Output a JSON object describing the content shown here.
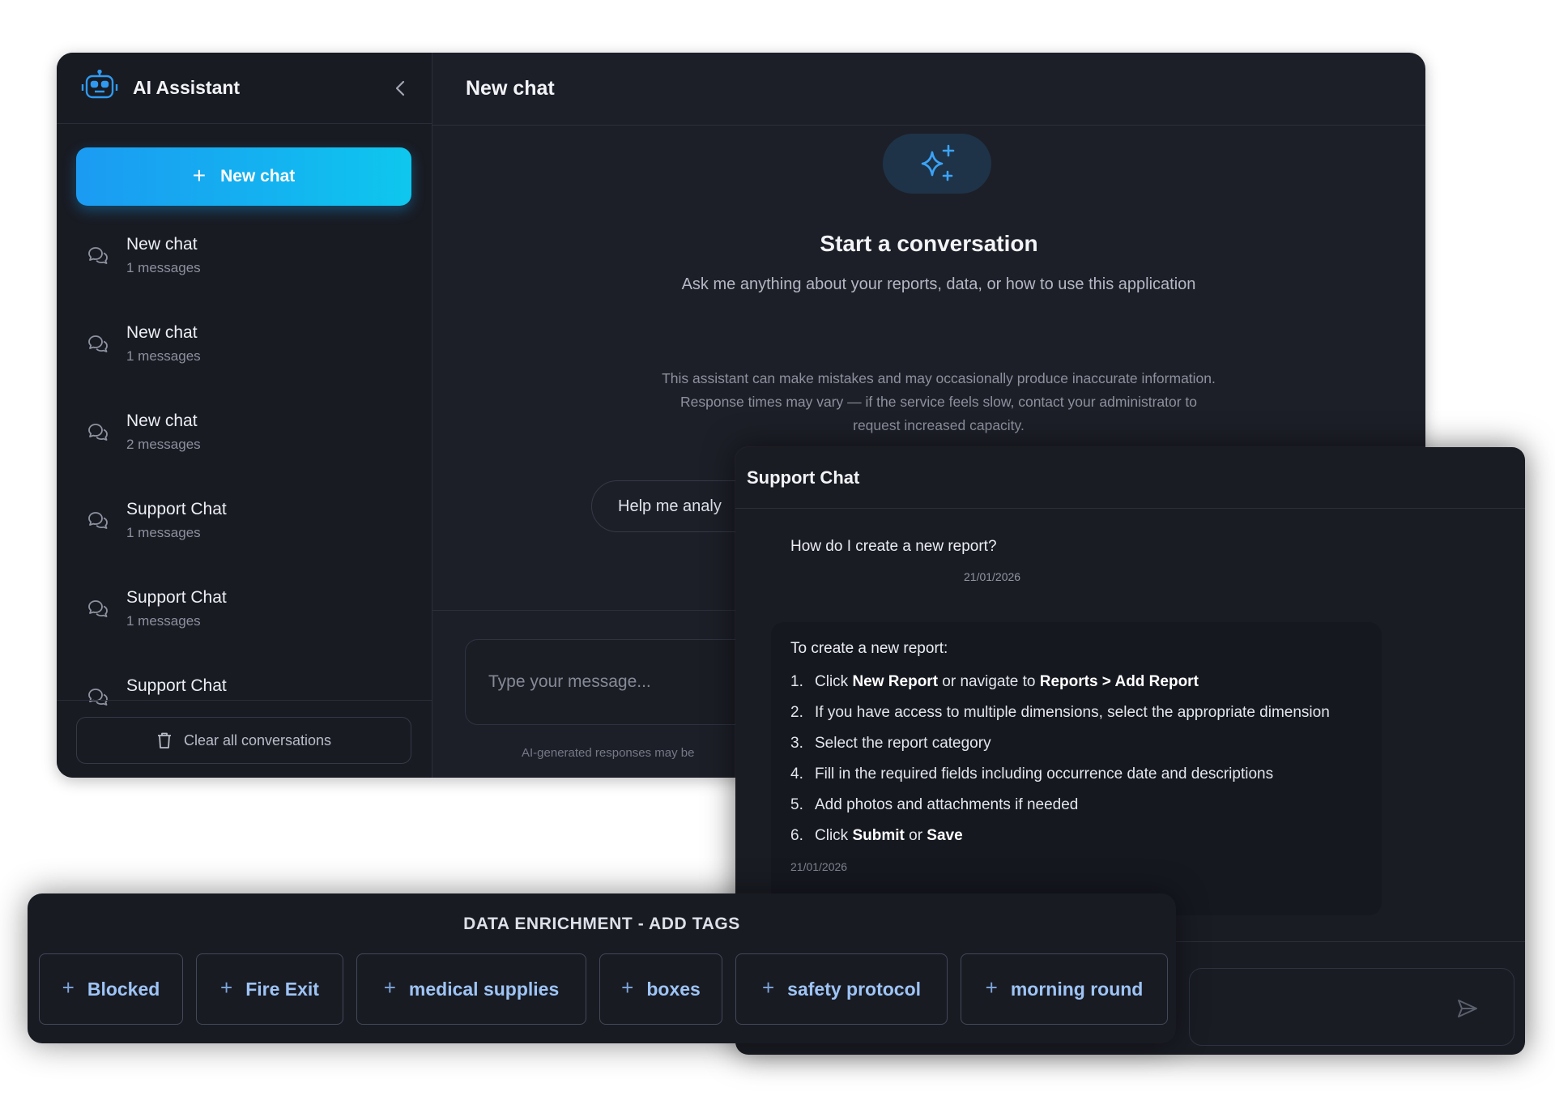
{
  "sidebar": {
    "title": "AI Assistant",
    "new_chat_label": "New chat",
    "conversations": [
      {
        "name": "New chat",
        "count": "1 messages"
      },
      {
        "name": "New chat",
        "count": "1 messages"
      },
      {
        "name": "New chat",
        "count": "2 messages"
      },
      {
        "name": "Support Chat",
        "count": "1 messages"
      },
      {
        "name": "Support Chat",
        "count": "1 messages"
      },
      {
        "name": "Support Chat",
        "count": ""
      }
    ],
    "clear_label": "Clear all conversations"
  },
  "main": {
    "title": "New chat",
    "welcome_title": "Start a conversation",
    "welcome_subtitle": "Ask me anything about your reports, data, or how to use this application",
    "disclaimer": "This assistant can make mistakes and may occasionally produce inaccurate information. Response times may vary — if the service feels slow, contact your administrator to request increased capacity.",
    "suggestion": "Help me analy",
    "input_placeholder": "Type your message...",
    "ai_note": "AI-generated responses may be"
  },
  "support_chat": {
    "title": "Support Chat",
    "user_message": "How do I create a new report?",
    "user_time": "21/01/2026",
    "ai_intro": "To create a new report:",
    "steps": [
      {
        "num": "1.",
        "parts": [
          {
            "t": "Click "
          },
          {
            "t": "New Report",
            "b": true
          },
          {
            "t": " or navigate to "
          },
          {
            "t": "Reports > Add Report",
            "b": true
          }
        ]
      },
      {
        "num": "2.",
        "parts": [
          {
            "t": "If you have access to multiple dimensions, select the appropriate dimension"
          }
        ]
      },
      {
        "num": "3.",
        "parts": [
          {
            "t": "Select the report category"
          }
        ]
      },
      {
        "num": "4.",
        "parts": [
          {
            "t": "Fill in the required fields including occurrence date and descriptions"
          }
        ]
      },
      {
        "num": "5.",
        "parts": [
          {
            "t": "Add photos and attachments if needed"
          }
        ]
      },
      {
        "num": "6.",
        "parts": [
          {
            "t": "Click "
          },
          {
            "t": "Submit",
            "b": true
          },
          {
            "t": " or "
          },
          {
            "t": "Save",
            "b": true
          }
        ]
      }
    ],
    "ai_time": "21/01/2026"
  },
  "tags_panel": {
    "title": "DATA ENRICHMENT - ADD TAGS",
    "tags": [
      "Blocked",
      "Fire Exit",
      "medical supplies",
      "boxes",
      "safety protocol",
      "morning round"
    ]
  },
  "colors": {
    "accent": "#1b9bf2",
    "accent_end": "#0ec7ee",
    "tag_text": "#9ec4f5",
    "panel_bg": "#1d1f28"
  },
  "icons": {
    "logo": "robot-icon",
    "collapse": "chevron-left-icon",
    "conversation": "chat-bubbles-icon",
    "clear": "trash-icon",
    "hero": "sparkles-icon",
    "send": "send-icon",
    "tag_add": "plus-icon"
  }
}
